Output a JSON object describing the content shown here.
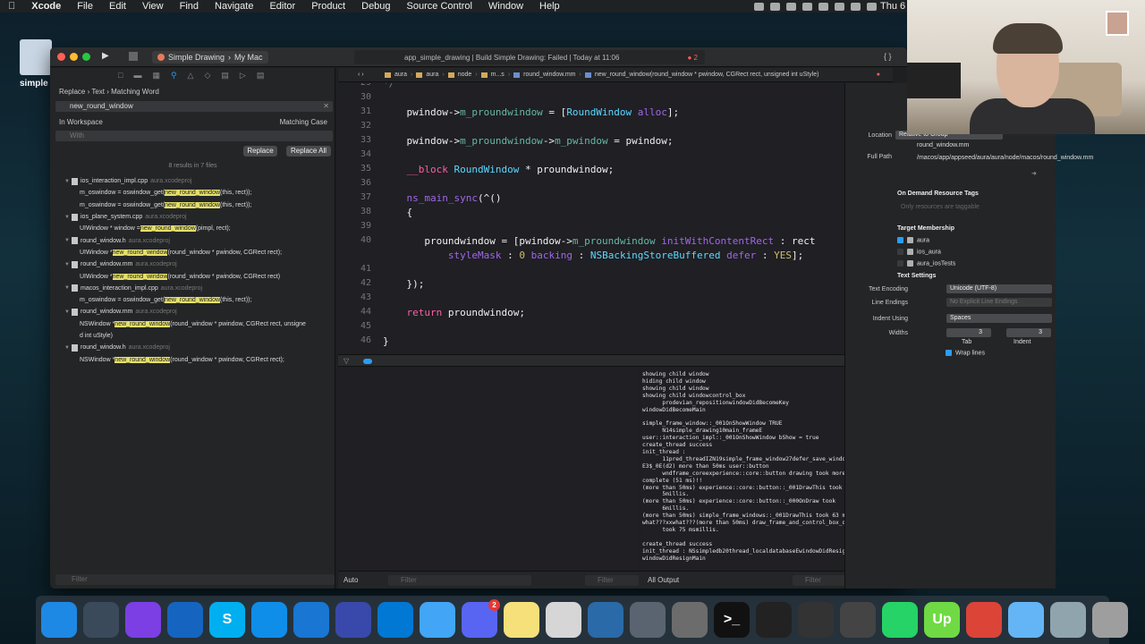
{
  "menubar": {
    "app": "Xcode",
    "items": [
      "File",
      "Edit",
      "View",
      "Find",
      "Navigate",
      "Editor",
      "Product",
      "Debug",
      "Source Control",
      "Window",
      "Help"
    ],
    "clock": "Thu 6"
  },
  "desktop": {
    "icon_label": "simple"
  },
  "toolbar": {
    "scheme": "Simple Drawing",
    "destination": "My Mac",
    "status": "app_simple_drawing | Build Simple Drawing: Failed | Today at 11:06",
    "error_count": "2"
  },
  "find_navigator": {
    "mode": [
      "Replace",
      "Text",
      "Matching Word"
    ],
    "search_value": "new_round_window",
    "scope": "In Workspace",
    "match_case": "Matching Case",
    "replace_placeholder": "With",
    "replace_button": "Replace",
    "replace_all_button": "Replace All",
    "summary": "8 results in 7 files",
    "filter_placeholder": "Filter",
    "results": [
      {
        "kind": "file",
        "name": "ios_interaction_impl.cpp",
        "project": "aura.xcodeproj"
      },
      {
        "kind": "match",
        "pre": "m_oswindow = oswindow_get(",
        "hit": "new_round_window",
        "post": "(this, rect));"
      },
      {
        "kind": "match",
        "pre": "m_oswindow = oswindow_get(",
        "hit": "new_round_window",
        "post": "(this, rect));"
      },
      {
        "kind": "file",
        "name": "ios_plane_system.cpp",
        "project": "aura.xcodeproj"
      },
      {
        "kind": "match",
        "pre": "UIWindow * window = ",
        "hit": "new_round_window",
        "post": "(pimpl, rect);"
      },
      {
        "kind": "file",
        "name": "round_window.h",
        "project": "aura.xcodeproj"
      },
      {
        "kind": "match",
        "pre": "UIWindow * ",
        "hit": "new_round_window",
        "post": "(round_window * pwindow, CGRect rect);"
      },
      {
        "kind": "file",
        "name": "round_window.mm",
        "project": "aura.xcodeproj"
      },
      {
        "kind": "match",
        "pre": "UIWindow * ",
        "hit": "new_round_window",
        "post": "(round_window * pwindow, CGRect rect)"
      },
      {
        "kind": "file",
        "name": "macos_interaction_impl.cpp",
        "project": "aura.xcodeproj"
      },
      {
        "kind": "match",
        "pre": "m_oswindow = oswindow_get(",
        "hit": "new_round_window",
        "post": "(this, rect));"
      },
      {
        "kind": "file",
        "name": "round_window.mm",
        "project": "aura.xcodeproj"
      },
      {
        "kind": "match",
        "pre": "NSWindow * ",
        "hit": "new_round_window",
        "post": "(round_window * pwindow, CGRect rect, unsigne"
      },
      {
        "kind": "match",
        "pre": "d int uStyle)",
        "hit": "",
        "post": ""
      },
      {
        "kind": "file",
        "name": "round_window.h",
        "project": "aura.xcodeproj"
      },
      {
        "kind": "match",
        "pre": "NSWindow * ",
        "hit": "new_round_window",
        "post": "(round_window * pwindow, CGRect rect);"
      }
    ]
  },
  "jumpbar": {
    "crumbs": [
      "aura",
      "aura",
      "node",
      "m...s",
      "round_window.mm",
      "new_round_window(round_window * pwindow, CGRect rect, unsigned int uStyle)"
    ]
  },
  "editor": {
    "lines": [
      {
        "n": "29",
        "t": "*/"
      },
      {
        "n": "30",
        "t": ""
      },
      {
        "n": "31",
        "t": "    pwindow->m_proundwindow = [RoundWindow alloc];"
      },
      {
        "n": "32",
        "t": ""
      },
      {
        "n": "33",
        "t": "    pwindow->m_proundwindow->m_pwindow = pwindow;"
      },
      {
        "n": "34",
        "t": ""
      },
      {
        "n": "35",
        "t": "    __block RoundWindow * proundwindow;"
      },
      {
        "n": "36",
        "t": ""
      },
      {
        "n": "37",
        "t": "    ns_main_sync(^()"
      },
      {
        "n": "38",
        "t": "    {"
      },
      {
        "n": "39",
        "t": ""
      },
      {
        "n": "40",
        "t": "       proundwindow = [pwindow->m_proundwindow initWithContentRect : rect"
      },
      {
        "n": "",
        "t": "           styleMask : 0 backing : NSBackingStoreBuffered defer : YES];"
      },
      {
        "n": "41",
        "t": ""
      },
      {
        "n": "42",
        "t": "    });"
      },
      {
        "n": "43",
        "t": ""
      },
      {
        "n": "44",
        "t": "    return proundwindow;"
      },
      {
        "n": "45",
        "t": ""
      },
      {
        "n": "46",
        "t": "}"
      }
    ]
  },
  "console": {
    "text": "showing child window\nhiding child window\nshowing child window\nshowing child windowcontrol_box\n      prodevian_repositionwindowDidBecomeKey\nwindowDidBecomeMain\n\nsimple_frame_window::_001OnShowWindow TRUE\n      N14simple_drawing10main_frameE\nuser::interaction_impl::_001OnShowWindow bShow = true\ncreate_thread success\ninit_thread :\n      11pred_threadIZN19simple_frame_window27defer_save_window_placementEvE3$_0E(d2) more than 50ms user::button\n      wndframe_coreexperience::core::button drawing took more than 50ms to complete (51 ms)!!\n(more than 50ms) experience::core::button::_001DrawThis took\n      5millis.\n(more than 50ms) experience::core::button::_000OnDraw took\n      6millis.\n(more than 50ms) simple_frame_windows::_001DrawThis took 63 ms.\nwhat???xxwhat???(more than 50ms) draw_frame_and_control_box_over\n      took 75 msmillis.\n\ncreate_thread success\ninit_thread : NSsimpledb20thread_localdatabaseEwindowDidResignKey\nwindowDidResignMain",
    "auto_label": "Auto",
    "output_label": "All Output",
    "filter_placeholder": "Filter"
  },
  "inspector": {
    "location_label": "Location",
    "location_value": "Relative to Group",
    "file_name": "round_window.mm",
    "full_path_label": "Full Path",
    "full_path": "/macos/app/appseed/aura/aura/node/macos/round_window.mm",
    "odr_title": "On Demand Resource Tags",
    "odr_placeholder": "Only resources are taggable",
    "membership_title": "Target Membership",
    "targets": [
      {
        "name": "aura",
        "checked": true
      },
      {
        "name": "ios_aura",
        "checked": false
      },
      {
        "name": "aura_iosTests",
        "checked": false
      }
    ],
    "text_settings_title": "Text Settings",
    "encoding_label": "Text Encoding",
    "encoding_value": "Unicode (UTF-8)",
    "line_endings_label": "Line Endings",
    "line_endings_value": "No Explicit Line Endings",
    "indent_label": "Indent Using",
    "indent_value": "Spaces",
    "widths_label": "Widths",
    "tab_width": "3",
    "indent_width": "3",
    "tab_label": "Tab",
    "indent_caption": "Indent",
    "wrap_label": "Wrap lines"
  },
  "dock": {
    "apps": [
      {
        "icon": "finder-icon",
        "glyph": "",
        "color": "#1e88e5"
      },
      {
        "icon": "launchpad-icon",
        "glyph": "",
        "color": "#3a4a5a"
      },
      {
        "icon": "siri-icon",
        "glyph": "",
        "color": "#7b3fe4"
      },
      {
        "icon": "safari-icon",
        "glyph": "",
        "color": "#1565c0"
      },
      {
        "icon": "skype-icon",
        "glyph": "S",
        "color": "#00aff0"
      },
      {
        "icon": "teamviewer-icon",
        "glyph": "",
        "color": "#0e8ee9"
      },
      {
        "icon": "xcode-icon",
        "glyph": "",
        "color": "#1976d2"
      },
      {
        "icon": "instruments-icon",
        "glyph": "",
        "color": "#3949ab"
      },
      {
        "icon": "vscode-icon",
        "glyph": "",
        "color": "#0078d4"
      },
      {
        "icon": "mail-icon",
        "glyph": "",
        "color": "#42a5f5"
      },
      {
        "icon": "discord-icon",
        "glyph": "",
        "color": "#5865f2",
        "badge": "2"
      },
      {
        "icon": "notes-icon",
        "glyph": "",
        "color": "#f5e07a"
      },
      {
        "icon": "preview-icon",
        "glyph": "",
        "color": "#d6d6d6"
      },
      {
        "icon": "aura-app-icon",
        "glyph": "",
        "color": "#2a6aa8"
      },
      {
        "icon": "rocket-icon",
        "glyph": "",
        "color": "#5a6470"
      },
      {
        "icon": "system-preferences-icon",
        "glyph": "",
        "color": "#6c6c6c"
      },
      {
        "icon": "terminal-icon",
        "glyph": ">_",
        "color": "#111"
      },
      {
        "icon": "obs-icon",
        "glyph": "",
        "color": "#222"
      },
      {
        "icon": "piano-icon",
        "glyph": "",
        "color": "#333"
      },
      {
        "icon": "pen-tool-icon",
        "glyph": "",
        "color": "#444"
      },
      {
        "icon": "whatsapp-icon",
        "glyph": "",
        "color": "#25d366"
      },
      {
        "icon": "upwork-icon",
        "glyph": "Up",
        "color": "#6fda44"
      },
      {
        "icon": "chrome-icon",
        "glyph": "",
        "color": "#db4437"
      },
      {
        "icon": "downloads-folder-icon",
        "glyph": "",
        "color": "#64b5f6"
      },
      {
        "icon": "screenshot-icon",
        "glyph": "",
        "color": "#90a4ae"
      },
      {
        "icon": "trash-icon",
        "glyph": "",
        "color": "#9e9e9e"
      }
    ]
  },
  "colors": {
    "accent": "#2a9df4",
    "highlight": "#e5e06a",
    "error": "#ff5f57"
  }
}
